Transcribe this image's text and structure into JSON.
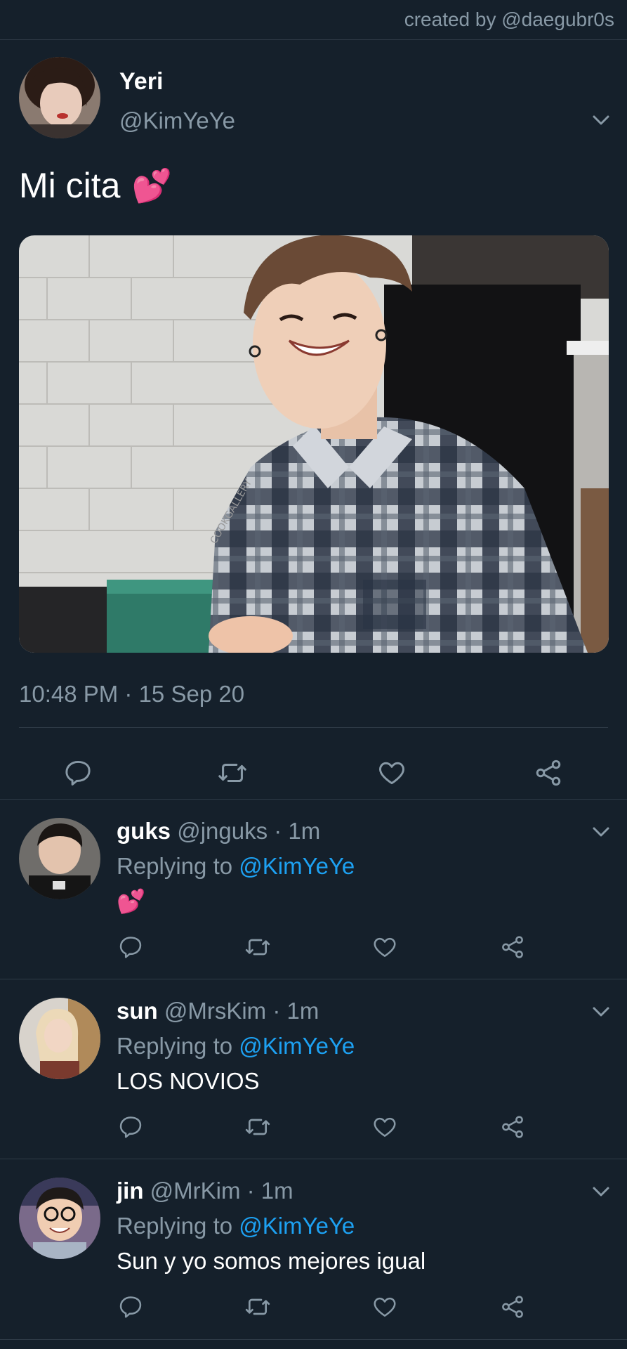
{
  "credit": "created by @daegubr0s",
  "main_tweet": {
    "name": "Yeri",
    "handle": "@KimYeYe",
    "text": "Mi cita",
    "emoji": "💕",
    "timestamp": "10:48 PM · 15 Sep 20",
    "photo_watermark": "COOKGALLERY"
  },
  "replies": [
    {
      "name": "guks",
      "handle": "@jnguks · 1m",
      "replying_label": "Replying to",
      "mention": "@KimYeYe",
      "text": "💕"
    },
    {
      "name": "sun",
      "handle": "@MrsKim · 1m",
      "replying_label": "Replying to",
      "mention": "@KimYeYe",
      "text": "LOS NOVIOS"
    },
    {
      "name": "jin",
      "handle": "@MrKim · 1m",
      "replying_label": "Replying to",
      "mention": "@KimYeYe",
      "text": "Sun y yo somos mejores igual"
    }
  ],
  "icons": [
    "chevron-down-icon",
    "reply-icon",
    "retweet-icon",
    "like-icon",
    "share-icon"
  ],
  "colors": {
    "background": "#15202b",
    "secondary_text": "#8899a6",
    "mention": "#1da1f2",
    "divider": "#2f3b47"
  }
}
